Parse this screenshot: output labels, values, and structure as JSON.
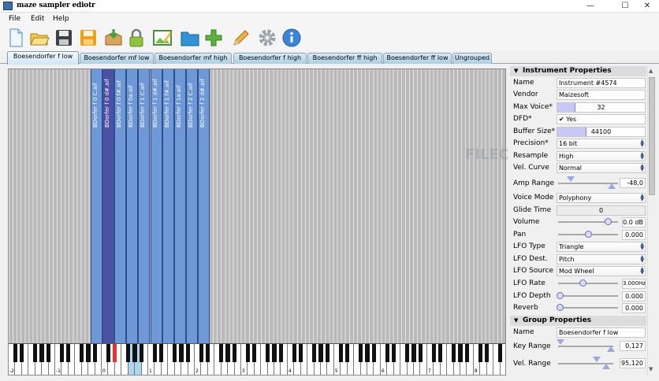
{
  "window": {
    "title": "maze sampler ediotr",
    "controls": [
      "—",
      "☐",
      "✕"
    ]
  },
  "menu": [
    "File",
    "Edit",
    "Help"
  ],
  "toolbar": [
    {
      "name": "new-file-icon",
      "glyph": "new"
    },
    {
      "name": "open-folder-icon",
      "glyph": "open"
    },
    {
      "name": "save-icon",
      "glyph": "save"
    },
    {
      "name": "save-as-icon",
      "glyph": "saveas"
    },
    {
      "name": "import-box-icon",
      "glyph": "import"
    },
    {
      "name": "lock-icon",
      "glyph": "lock"
    },
    {
      "name": "image-edit-icon",
      "glyph": "image"
    },
    {
      "name": "folder-icon",
      "glyph": "folder"
    },
    {
      "name": "add-icon",
      "glyph": "add"
    },
    {
      "name": "pencil-icon",
      "glyph": "pencil"
    },
    {
      "name": "gear-icon",
      "glyph": "gear"
    },
    {
      "name": "info-icon",
      "glyph": "info"
    }
  ],
  "tabs": [
    "Boesendorfer  f  low",
    "Boesendorfer  mf  low",
    "Boesendorfer  mf  high",
    "Boesendorfer  f  high",
    "Boesendorfer  ff  high",
    "Boesendorfer  ff  low",
    "Ungrouped"
  ],
  "active_tab": 0,
  "samples": [
    "BDorfer f  0 C.aif",
    "BDorfer f  0 d#.aif",
    "BDorfer f  0 f#.aif",
    "BDorfer f  0a.aif",
    "BDorfer f  1 C.aif",
    "BDorfer f  1 d#.aif",
    "BDorfer f  1 f#.aif",
    "BDorfer f  1a.aif",
    "BDorfer f  2 C.aif",
    "BDorfer f  2 d#.aif"
  ],
  "octave_labels": [
    "-2",
    "-1",
    "0",
    "1",
    "2",
    "3",
    "4",
    "5",
    "6",
    "7",
    "8"
  ],
  "watermark": "FILECR",
  "instrument": {
    "header": "Instrument Properties",
    "name_label": "Name",
    "name": "Instrument #4574",
    "vendor_label": "Vendor",
    "vendor": "Maizesoft",
    "max_voice_label": "Max Voice*",
    "max_voice": "32",
    "max_voice_fill": 0.2,
    "dfd_label": "DFD*",
    "dfd": "Yes",
    "dfd_check": "✔",
    "buffer_label": "Buffer Size*",
    "buffer": "44100",
    "buffer_fill": 0.33,
    "precision_label": "Precision*",
    "precision": "16 bit",
    "resample_label": "Resample",
    "resample": "High",
    "vel_curve_label": "Vel. Curve",
    "vel_curve": "Normal",
    "amp_range_label": "Amp Range",
    "amp_range": "-48,0",
    "voice_mode_label": "Voice Mode",
    "voice_mode": "Polyphony",
    "glide_label": "Glide Time",
    "glide": "0",
    "volume_label": "Volume",
    "volume": "0.0 dB",
    "volume_pos": 0.85,
    "pan_label": "Pan",
    "pan": "0.000",
    "pan_pos": 0.5,
    "lfo_type_label": "LFO Type",
    "lfo_type": "Triangle",
    "lfo_dest_label": "LFO Dest.",
    "lfo_dest": "Pitch",
    "lfo_source_label": "LFO Source",
    "lfo_source": "Mod Wheel",
    "lfo_rate_label": "LFO Rate",
    "lfo_rate": "3.000Hz",
    "lfo_rate_pos": 0.4,
    "lfo_depth_label": "LFO Depth",
    "lfo_depth": "0.000",
    "lfo_depth_pos": 0.0,
    "reverb_label": "Reverb",
    "reverb": "0.000",
    "reverb_pos": 0.0
  },
  "group": {
    "header": "Group Properties",
    "name_label": "Name",
    "name": "Boesendorfer  f  low",
    "key_range_label": "Key Range",
    "key_range": "0,127",
    "vel_range_label": "Vel. Range",
    "vel_range": "95,120"
  }
}
